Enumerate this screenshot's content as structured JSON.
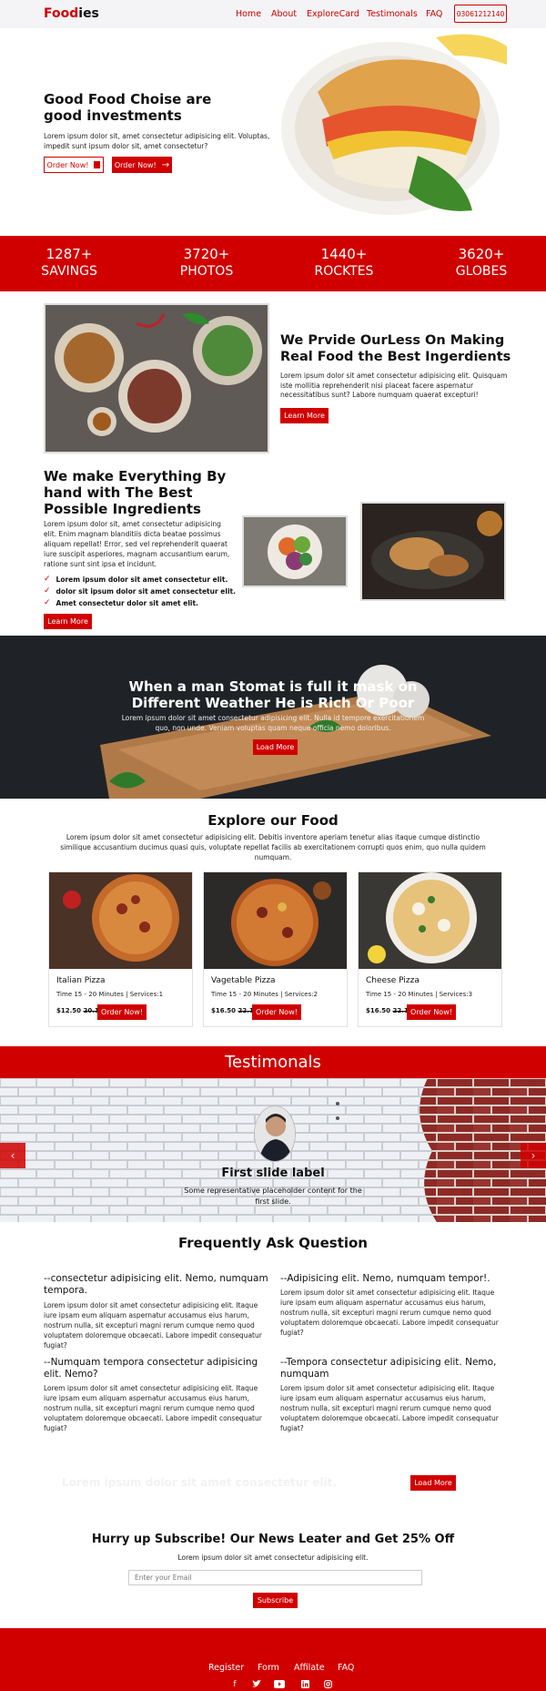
{
  "nav": {
    "brand_part1": "Food",
    "brand_part2": "ies",
    "links": [
      "Home",
      "About",
      "ExploreCard",
      "Testimonals",
      "FAQ"
    ],
    "phone": "03061212140"
  },
  "hero": {
    "title": "Good Food Choise are good investments",
    "text": "Lorem ipsum dolor sit, amet consectetur adipisicing elit. Voluptas, impedit sunt ipsum dolor sit, amet consectetur?",
    "btn1": "Order Now!",
    "btn2": "Order Now!"
  },
  "stats": [
    {
      "number": "1287+",
      "label": "SAVINGS"
    },
    {
      "number": "3720+",
      "label": "PHOTOS"
    },
    {
      "number": "1440+",
      "label": "ROCKTES"
    },
    {
      "number": "3620+",
      "label": "GLOBES"
    }
  ],
  "provide": {
    "title": "We Prvide OurLess On Making Real Food the Best Ingerdients",
    "text": "Lorem ipsum dolor sit amet consectetur adipisicing elit. Quisquam iste mollitia reprehenderit nisi placeat facere aspernatur necessitatibus sunt? Labore numquam quaerat excepturi!",
    "button": "Learn More"
  },
  "make": {
    "title": "We make Everything By hand with The Best Possible Ingredients",
    "text": "Lorem ipsum dolor sit, amet consectetur adipisicing elit. Enim magnam blanditiis dicta beatae possimus aliquam repellat! Error, sed vel reprehenderit quaerat iure suscipit asperiores, magnam accusantium earum, ratione sunt sint ipsa et incidunt.",
    "checks": [
      "Lorem ipsum dolor sit amet consectetur elit.",
      "dolor sit ipsum dolor sit amet consectetur elit.",
      "Amet consectetur dolor sit amet elit."
    ],
    "button": "Learn More"
  },
  "banner": {
    "title": "When a man Stomat is full it mask on Different Weather He is Rich Or Poor",
    "text": "Lorem ipsum dolor sit amet consectetur adipisicing elit. Nulla id tempore exercitationem quo, non unde. Veniam voluptas quam neque officia nemo doloribus.",
    "button": "Load More"
  },
  "explore": {
    "title": "Explore our Food",
    "text": "Lorem ipsum dolor sit amet consectetur adipisicing elit. Debitis inventore aperiam tenetur alias itaque cumque distinctio similique accusantium ducimus quasi quis, voluptate repellat facilis ab exercitationem corrupti quos enim, quo nulla quidem numquam.",
    "cards": [
      {
        "name": "Italian Pizza",
        "meta": "Time 15 - 20 Minutes | Services:1",
        "price": "$12.50",
        "old_price": "20.12",
        "button": "Order Now!"
      },
      {
        "name": "Vagetable Pizza",
        "meta": "Time 15 - 20 Minutes | Services:2",
        "price": "$16.50",
        "old_price": "22.12",
        "button": "Order Now!"
      },
      {
        "name": "Cheese Pizza",
        "meta": "Time 15 - 20 Minutes | Services:3",
        "price": "$16.50",
        "old_price": "22.12",
        "button": "Order Now!"
      }
    ]
  },
  "testimonials": {
    "heading": "Testimonals",
    "slide_label": "First slide label",
    "slide_text": "Some representative placeholder content for the first slide."
  },
  "faq": {
    "title": "Frequently Ask Question",
    "items": [
      {
        "q": "--consectetur adipisicing elit. Nemo, numquam tempora.",
        "a": "Lorem ipsum dolor sit amet consectetur adipisicing elit. Itaque iure ipsam eum aliquam aspernatur accusamus eius harum, nostrum nulla, sit excepturi magni rerum cumque nemo quod voluptatem doloremque obcaecati. Labore impedit consequatur fugiat?"
      },
      {
        "q": "--Adipisicing elit. Nemo, numquam tempor!.",
        "a": "Lorem ipsum dolor sit amet consectetur adipisicing elit. Itaque iure ipsam eum aliquam aspernatur accusamus eius harum, nostrum nulla, sit excepturi magni rerum cumque nemo quod voluptatem doloremque obcaecati. Labore impedit consequatur fugiat?"
      },
      {
        "q": "--Numquam tempora consectetur adipisicing elit. Nemo?",
        "a": "Lorem ipsum dolor sit amet consectetur adipisicing elit. Itaque iure ipsam eum aliquam aspernatur accusamus eius harum, nostrum nulla, sit excepturi magni rerum cumque nemo quod voluptatem doloremque obcaecati. Labore impedit consequatur fugiat?"
      },
      {
        "q": "--Tempora consectetur adipisicing elit. Nemo, numquam",
        "a": "Lorem ipsum dolor sit amet consectetur adipisicing elit. Itaque iure ipsam eum aliquam aspernatur accusamus eius harum, nostrum nulla, sit excepturi magni rerum cumque nemo quod voluptatem doloremque obcaecati. Labore impedit consequatur fugiat?"
      }
    ],
    "ghost_text": "Lorem ipsum dolor sit amet consectetur elit.",
    "load_more": "Load More"
  },
  "subscribe": {
    "title": "Hurry up Subscribe! Our News Leater and Get 25% Off",
    "text": "Lorem ipsum dolor sit amet consectetur adipisicing elit.",
    "placeholder": "Enter your Email",
    "button": "Subscribe"
  },
  "footer": {
    "links": [
      "Register",
      "Form",
      "Affilate",
      "FAQ"
    ],
    "social_icons": [
      "facebook-icon",
      "twitter-icon",
      "youtube-icon",
      "linkedin-icon",
      "instagram-icon"
    ]
  },
  "colors": {
    "accent": "#d10000",
    "dark": "#1f2327"
  }
}
